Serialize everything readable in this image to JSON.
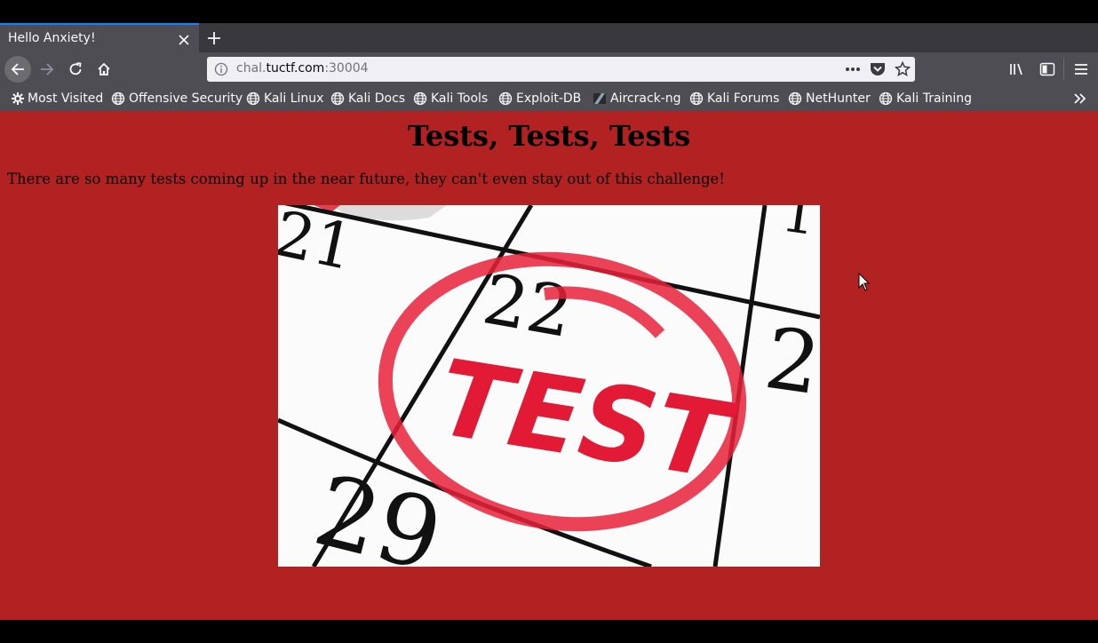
{
  "browser": {
    "tab": {
      "title": "Hello Anxiety!"
    },
    "url": {
      "prefix": "chal.",
      "domain": "tuctf.com",
      "suffix": ":30004"
    },
    "bookmarks": [
      {
        "label": "Most Visited",
        "icon": "gear-icon"
      },
      {
        "label": "Offensive Security",
        "icon": "globe-icon"
      },
      {
        "label": "Kali Linux",
        "icon": "globe-icon"
      },
      {
        "label": "Kali Docs",
        "icon": "globe-icon"
      },
      {
        "label": "Kali Tools",
        "icon": "globe-icon"
      },
      {
        "label": "Exploit-DB",
        "icon": "globe-icon"
      },
      {
        "label": "Aircrack-ng",
        "icon": "aircrack-icon"
      },
      {
        "label": "Kali Forums",
        "icon": "globe-icon"
      },
      {
        "label": "NetHunter",
        "icon": "globe-icon"
      },
      {
        "label": "Kali Training",
        "icon": "globe-icon"
      }
    ]
  },
  "page": {
    "heading": "Tests, Tests, Tests",
    "paragraph": "There are so many tests coming up in the near future, they can't even stay out of this challenge!",
    "image": {
      "calendar_numbers": [
        "21",
        "22",
        "1",
        "2",
        "29"
      ],
      "stamp_text": "TEST",
      "stamp_color": "#e8213b"
    },
    "background_color": "#b22222"
  }
}
